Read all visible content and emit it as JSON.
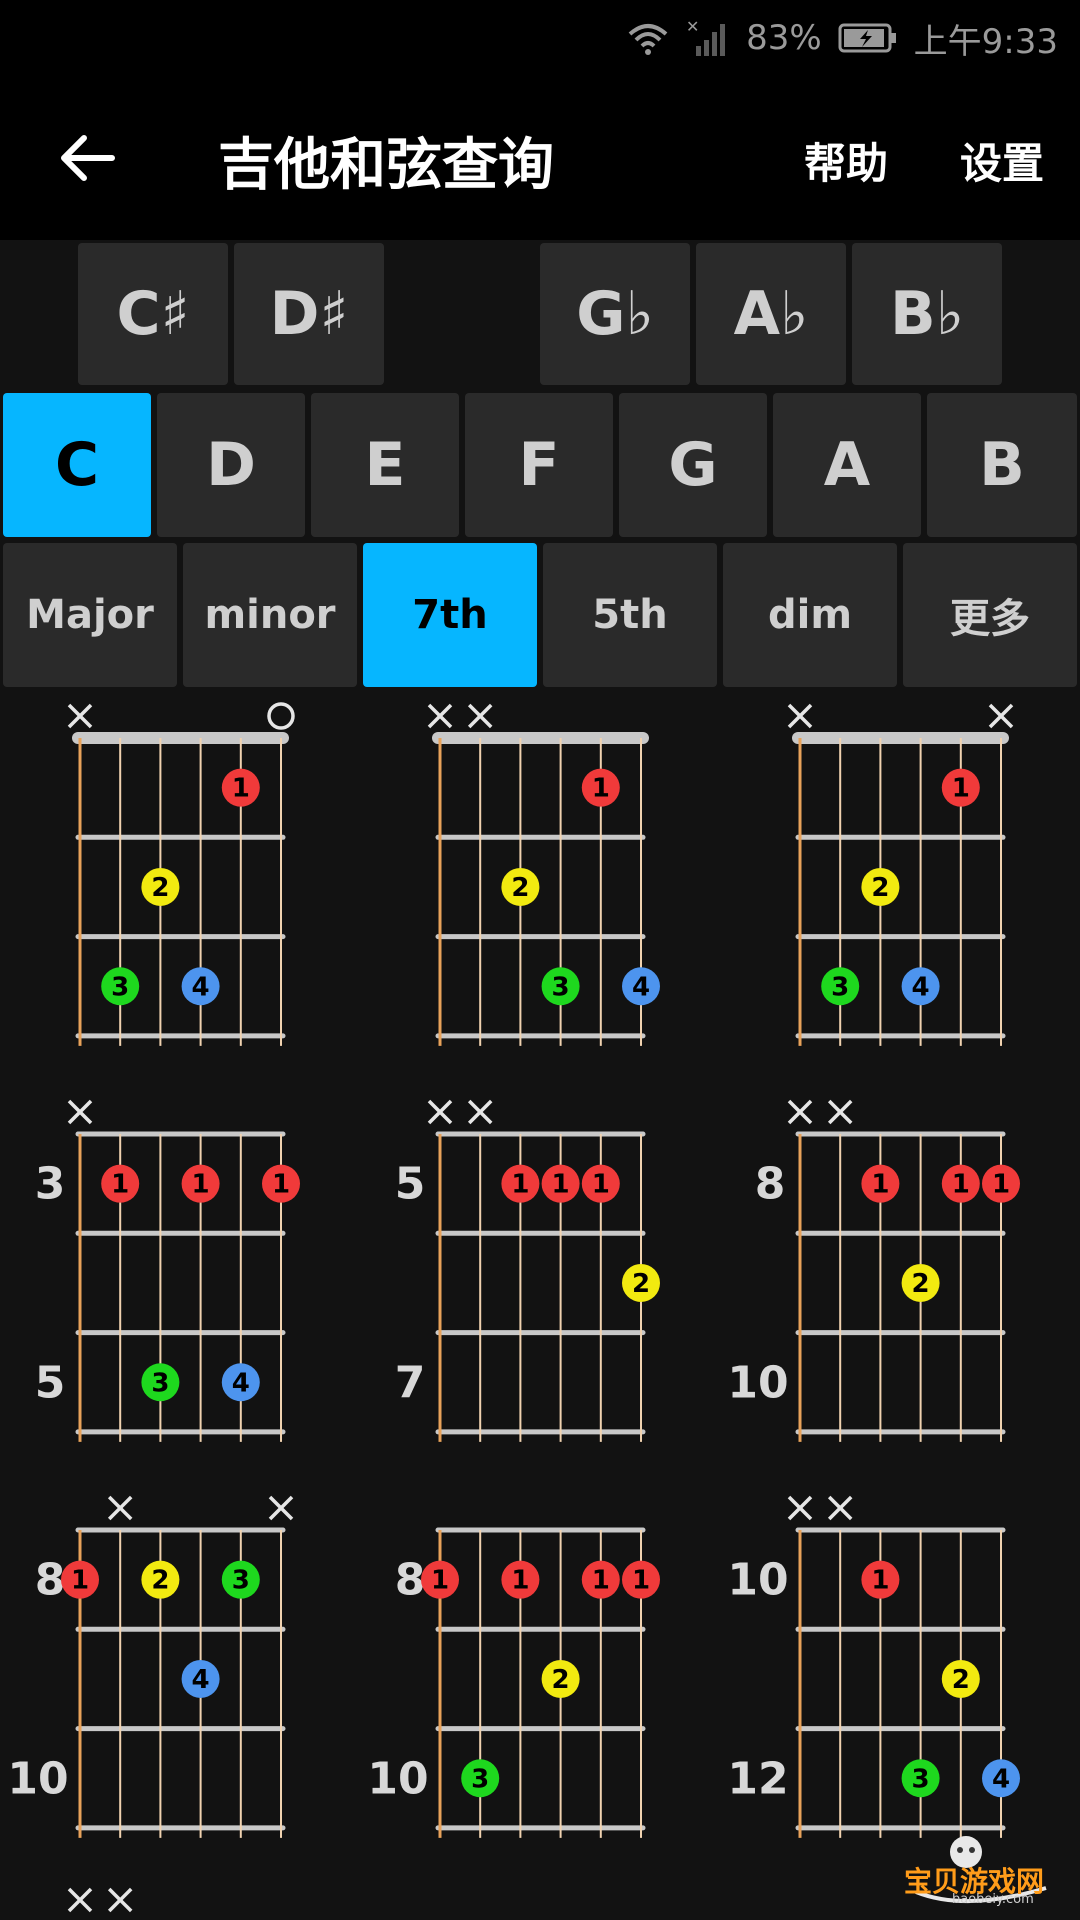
{
  "status_bar": {
    "battery": "83%",
    "time": "上午9:33",
    "icons": [
      "wifi-icon",
      "no-sim-icon",
      "signal-icon",
      "battery-icon"
    ]
  },
  "app_bar": {
    "title": "吉他和弦查询",
    "help": "帮助",
    "settings": "设置",
    "back_icon": "arrow-left-icon"
  },
  "accidentals": [
    "C♯",
    "D♯",
    "G♭",
    "A♭",
    "B♭"
  ],
  "roots": [
    "C",
    "D",
    "E",
    "F",
    "G",
    "A",
    "B"
  ],
  "selected_root": "C",
  "types": [
    "Major",
    "minor",
    "7th",
    "5th",
    "dim",
    "更多"
  ],
  "selected_type": "7th",
  "colors": {
    "accent": "#06b6ff",
    "finger1": "#f03a3a",
    "finger2": "#f2ea10",
    "finger3": "#1ed81e",
    "finger4": "#4d94ee",
    "string": "#e8a25a",
    "fret": "#c8c8c8"
  },
  "chords": [
    {
      "nut": true,
      "labels": [],
      "markers": [
        "x",
        "",
        "",
        "",
        "",
        "o"
      ],
      "dots": [
        [
          5,
          1,
          1
        ],
        [
          3,
          2,
          2
        ],
        [
          2,
          3,
          3
        ],
        [
          4,
          3,
          4
        ]
      ]
    },
    {
      "nut": true,
      "labels": [],
      "markers": [
        "x",
        "x",
        "",
        "",
        "",
        ""
      ],
      "dots": [
        [
          5,
          1,
          1
        ],
        [
          3,
          2,
          2
        ],
        [
          4,
          3,
          3
        ],
        [
          6,
          3,
          4
        ]
      ]
    },
    {
      "nut": true,
      "labels": [],
      "markers": [
        "x",
        "",
        "",
        "",
        "",
        "x"
      ],
      "dots": [
        [
          5,
          1,
          1
        ],
        [
          3,
          2,
          2
        ],
        [
          2,
          3,
          3
        ],
        [
          4,
          3,
          4
        ]
      ]
    },
    {
      "nut": false,
      "labels": [
        "3",
        "5"
      ],
      "markers": [
        "x",
        "",
        "",
        "",
        "",
        ""
      ],
      "dots": [
        [
          2,
          1,
          1
        ],
        [
          4,
          1,
          1
        ],
        [
          6,
          1,
          1
        ],
        [
          3,
          3,
          3
        ],
        [
          5,
          3,
          4
        ]
      ]
    },
    {
      "nut": false,
      "labels": [
        "5",
        "7"
      ],
      "markers": [
        "x",
        "x",
        "",
        "",
        "",
        ""
      ],
      "dots": [
        [
          3,
          1,
          1
        ],
        [
          4,
          1,
          1
        ],
        [
          5,
          1,
          1
        ],
        [
          6,
          2,
          2
        ]
      ]
    },
    {
      "nut": false,
      "labels": [
        "8",
        "10"
      ],
      "markers": [
        "x",
        "x",
        "",
        "",
        "",
        ""
      ],
      "dots": [
        [
          3,
          1,
          1
        ],
        [
          5,
          1,
          1
        ],
        [
          6,
          1,
          1
        ],
        [
          4,
          2,
          2
        ]
      ]
    },
    {
      "nut": false,
      "labels": [
        "8",
        "10"
      ],
      "markers": [
        "",
        "x",
        "",
        "",
        "",
        "x"
      ],
      "dots": [
        [
          1,
          1,
          1
        ],
        [
          3,
          1,
          2
        ],
        [
          5,
          1,
          3
        ],
        [
          4,
          2,
          4
        ]
      ]
    },
    {
      "nut": false,
      "labels": [
        "8",
        "10"
      ],
      "markers": [
        "",
        "",
        "",
        "",
        "",
        ""
      ],
      "dots": [
        [
          1,
          1,
          1
        ],
        [
          3,
          1,
          1
        ],
        [
          5,
          1,
          1
        ],
        [
          6,
          1,
          1
        ],
        [
          4,
          2,
          2
        ],
        [
          2,
          3,
          3
        ]
      ]
    },
    {
      "nut": false,
      "labels": [
        "10",
        "12"
      ],
      "markers": [
        "x",
        "x",
        "",
        "",
        "",
        ""
      ],
      "dots": [
        [
          3,
          1,
          1
        ],
        [
          5,
          2,
          2
        ],
        [
          4,
          3,
          3
        ],
        [
          6,
          3,
          4
        ]
      ]
    }
  ],
  "partial_markers": [
    "x",
    "x"
  ],
  "watermark": {
    "text": "宝贝游戏网",
    "url": "baobeiy.com"
  }
}
